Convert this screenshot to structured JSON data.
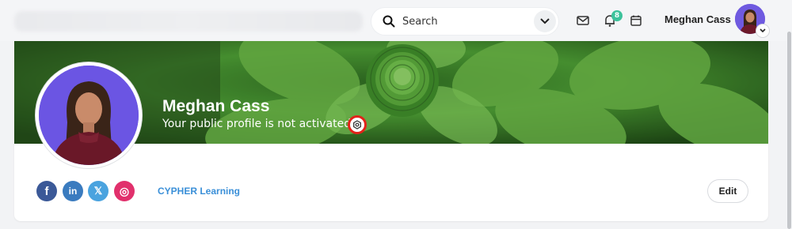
{
  "header": {
    "search_placeholder": "Search",
    "notification_count": "8",
    "user_name": "Meghan Cass"
  },
  "profile": {
    "name": "Meghan Cass",
    "status": "Your public profile is not activated",
    "organization": "CYPHER Learning",
    "edit_label": "Edit"
  },
  "social": [
    {
      "name": "facebook",
      "glyph": "f",
      "color": "#3b5998"
    },
    {
      "name": "linkedin",
      "glyph": "in",
      "color": "#3a7bbf"
    },
    {
      "name": "x",
      "glyph": "𝕏",
      "color": "#4aa3df"
    },
    {
      "name": "instagram",
      "glyph": "◎",
      "color": "#e1306c"
    }
  ],
  "colors": {
    "accent_link": "#3a8fd8",
    "badge": "#3cc29b",
    "avatar_bg": "#6b55e3",
    "highlight_ring": "#e2231a"
  }
}
